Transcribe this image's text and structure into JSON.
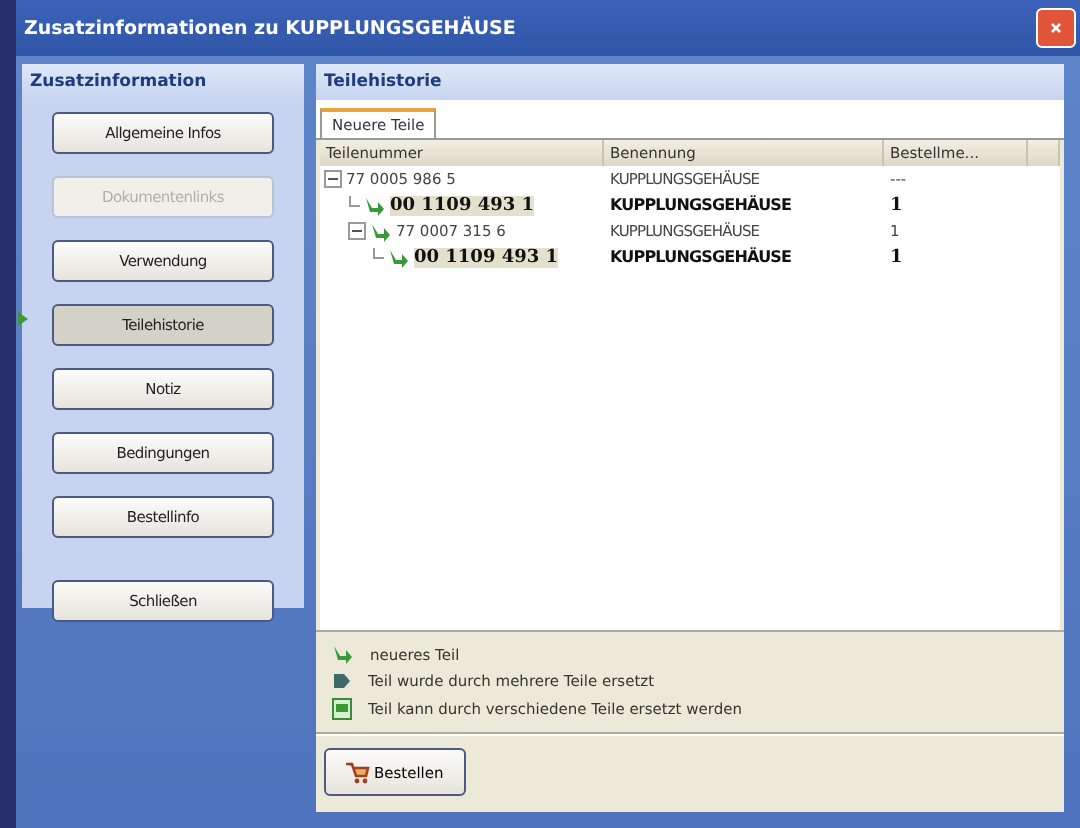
{
  "window": {
    "title": "Zusatzinformationen zu KUPPLUNGSGEHÄUSE"
  },
  "sidebar": {
    "title": "Zusatzinformation",
    "items": [
      {
        "label": "Allgemeine Infos",
        "selected": false,
        "disabled": false
      },
      {
        "label": "Dokumentenlinks",
        "selected": false,
        "disabled": true
      },
      {
        "label": "Verwendung",
        "selected": false,
        "disabled": false
      },
      {
        "label": "Teilehistorie",
        "selected": true,
        "disabled": false
      },
      {
        "label": "Notiz",
        "selected": false,
        "disabled": false
      },
      {
        "label": "Bedingungen",
        "selected": false,
        "disabled": false
      },
      {
        "label": "Bestellinfo",
        "selected": false,
        "disabled": false
      }
    ],
    "close_button": "Schließen"
  },
  "panel": {
    "title": "Teilehistorie",
    "tabs": [
      {
        "label": "Neuere Teile",
        "selected": true
      }
    ],
    "table": {
      "columns": [
        "Teilenummer",
        "Benennung",
        "Bestellme..."
      ],
      "rows": [
        {
          "part": "77 0005 986 5",
          "name": "KUPPLUNGSGEHÄUSE",
          "quantity": "---",
          "newer": false,
          "highlighted": false,
          "expanded": true,
          "children": [
            {
              "part": "00 1109 493 1",
              "name": "KUPPLUNGSGEHÄUSE",
              "quantity": "1",
              "newer": true,
              "highlighted": true
            },
            {
              "part": "77 0007 315 6",
              "name": "KUPPLUNGSGEHÄUSE",
              "quantity": "1",
              "newer": true,
              "highlighted": false,
              "expanded": true,
              "children": [
                {
                  "part": "00 1109 493 1",
                  "name": "KUPPLUNGSGEHÄUSE",
                  "quantity": "1",
                  "newer": true,
                  "highlighted": true
                }
              ]
            }
          ]
        }
      ]
    },
    "legend": [
      {
        "kind": "newer",
        "text": "neueres Teil"
      },
      {
        "kind": "multiple",
        "text": "Teil wurde durch mehrere Teile ersetzt"
      },
      {
        "kind": "alternatives",
        "text": "Teil kann durch verschiedene Teile ersetzt werden"
      }
    ],
    "order_button": "Bestellen"
  }
}
